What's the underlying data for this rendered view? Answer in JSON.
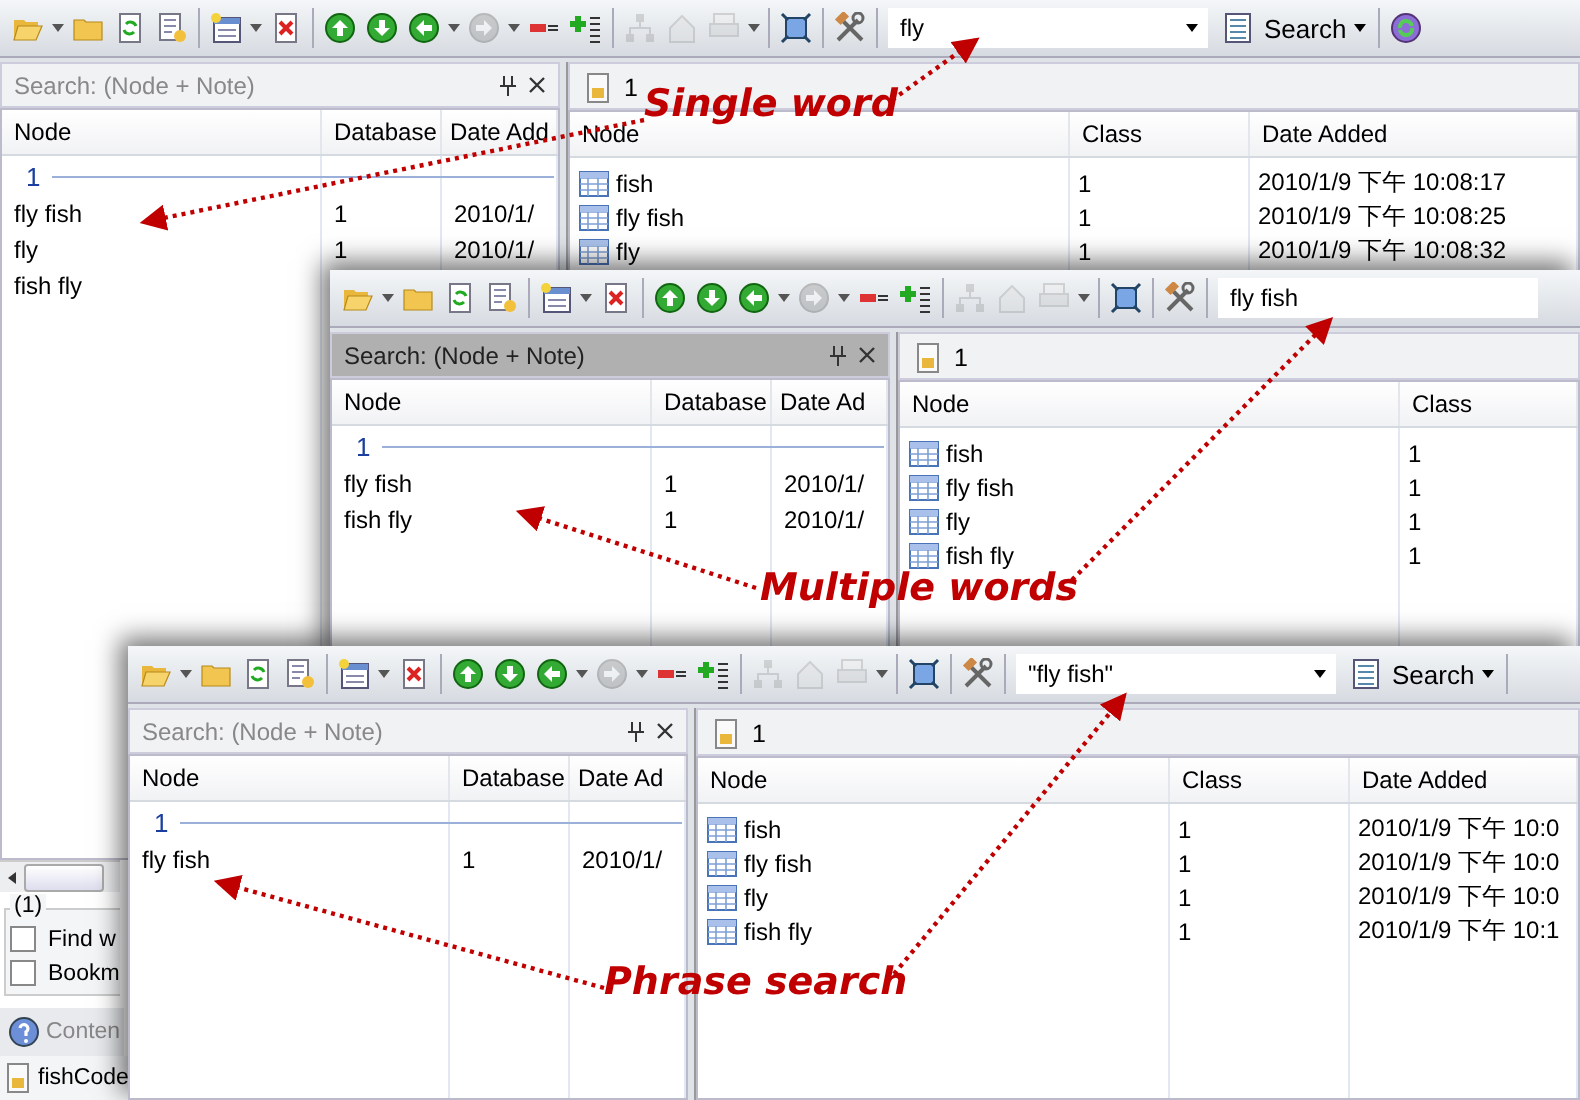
{
  "windows": [
    {
      "search": {
        "value": "fly",
        "button": "Search"
      },
      "sync_button": true,
      "left": {
        "title": "Search: (Node + Note)",
        "active": false,
        "columns": [
          "Node",
          "Database",
          "Date Add"
        ],
        "group": "1",
        "rows": [
          [
            "fly fish",
            "1",
            "2010/1/"
          ],
          [
            "fly",
            "1",
            "2010/1/"
          ],
          [
            "fish fly"
          ]
        ]
      },
      "right": {
        "tab": "1",
        "columns": [
          "Node",
          "Class",
          "Date Added"
        ],
        "rows": [
          [
            "fish",
            "1",
            "2010/1/9 下午 10:08:17"
          ],
          [
            "fly fish",
            "1",
            "2010/1/9 下午 10:08:25"
          ],
          [
            "fly",
            "1",
            "2010/1/9 下午 10:08:32"
          ]
        ]
      },
      "footer": {
        "group": "(1)",
        "options": [
          {
            "label": "Find w",
            "checked": false
          },
          {
            "label": "Bookm",
            "checked": false
          }
        ],
        "tab": "Conten",
        "item": "fishCode"
      }
    },
    {
      "search": {
        "value": "fly fish"
      },
      "sync_button": false,
      "left": {
        "title": "Search: (Node + Note)",
        "active": true,
        "columns": [
          "Node",
          "Database",
          "Date Ad"
        ],
        "group": "1",
        "rows": [
          [
            "fly fish",
            "1",
            "2010/1/"
          ],
          [
            "fish fly",
            "1",
            "2010/1/"
          ]
        ]
      },
      "right": {
        "tab": "1",
        "columns": [
          "Node",
          "Class"
        ],
        "rows": [
          [
            "fish",
            "1"
          ],
          [
            "fly fish",
            "1"
          ],
          [
            "fly",
            "1"
          ],
          [
            "fish fly",
            "1"
          ]
        ]
      }
    },
    {
      "search": {
        "value": "\"fly fish\"",
        "button": "Search"
      },
      "sync_button": false,
      "left": {
        "title": "Search: (Node + Note)",
        "active": false,
        "columns": [
          "Node",
          "Database",
          "Date Ad"
        ],
        "group": "1",
        "rows": [
          [
            "fly fish",
            "1",
            "2010/1/"
          ]
        ]
      },
      "right": {
        "tab": "1",
        "columns": [
          "Node",
          "Class",
          "Date Added"
        ],
        "rows": [
          [
            "fish",
            "1",
            "2010/1/9 下午 10:0"
          ],
          [
            "fly fish",
            "1",
            "2010/1/9 下午 10:0"
          ],
          [
            "fly",
            "1",
            "2010/1/9 下午 10:0"
          ],
          [
            "fish fly",
            "1",
            "2010/1/9 下午 10:1"
          ]
        ]
      }
    }
  ],
  "callouts": [
    {
      "text": "Single word"
    },
    {
      "text": "Multiple words"
    },
    {
      "text": "Phrase search"
    }
  ]
}
